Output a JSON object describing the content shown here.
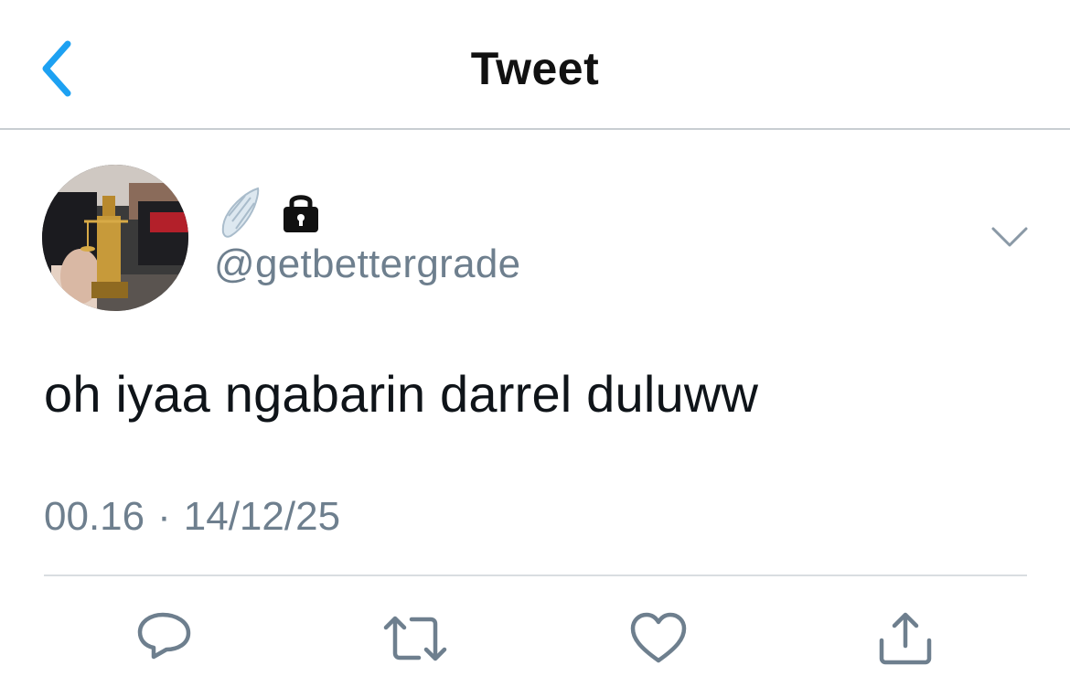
{
  "nav": {
    "title": "Tweet",
    "back_icon": "chevron-left-icon",
    "accent_color": "#1da1f2"
  },
  "author": {
    "handle": "@getbettergrade",
    "badges": [
      "wing-emoji-icon",
      "lock-icon"
    ]
  },
  "tweet": {
    "text": "oh iyaa ngabarin darrel duluww",
    "time": "00.16",
    "separator": "·",
    "date": "14/12/25"
  },
  "actions": [
    "reply-icon",
    "retweet-icon",
    "like-icon",
    "share-icon"
  ],
  "colors": {
    "secondary_text": "#6e7f8e",
    "icon_gray": "#6e7f8e",
    "divider": "#d9dde1"
  }
}
